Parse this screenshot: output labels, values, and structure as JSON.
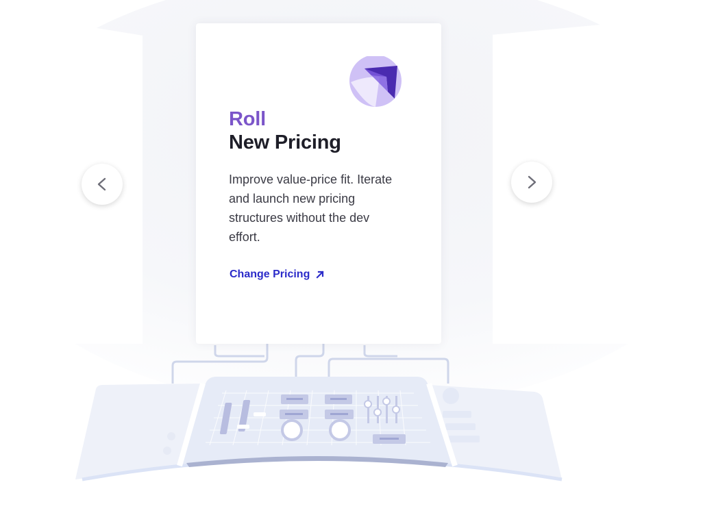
{
  "carousel": {
    "prev_label": "<",
    "next_label": ">",
    "card": {
      "kicker": "Roll",
      "title": "New Pricing",
      "body": "Improve value-price fit. Iterate and launch new pricing structures without the dev effort.",
      "link_label": "Change Pricing",
      "link_icon": "arrow-up-right-icon",
      "logo_icon": "purple-arrow-logo-icon"
    }
  },
  "colors": {
    "kicker": "#7b55c9",
    "title": "#1e1e28",
    "body": "#3a3a44",
    "link": "#2b2bc9",
    "nav_glyph": "#6e6e78",
    "logo_light": "#cfc1f6",
    "logo_dark": "#4a2bb0",
    "dashboard": "#dfe5f5"
  }
}
